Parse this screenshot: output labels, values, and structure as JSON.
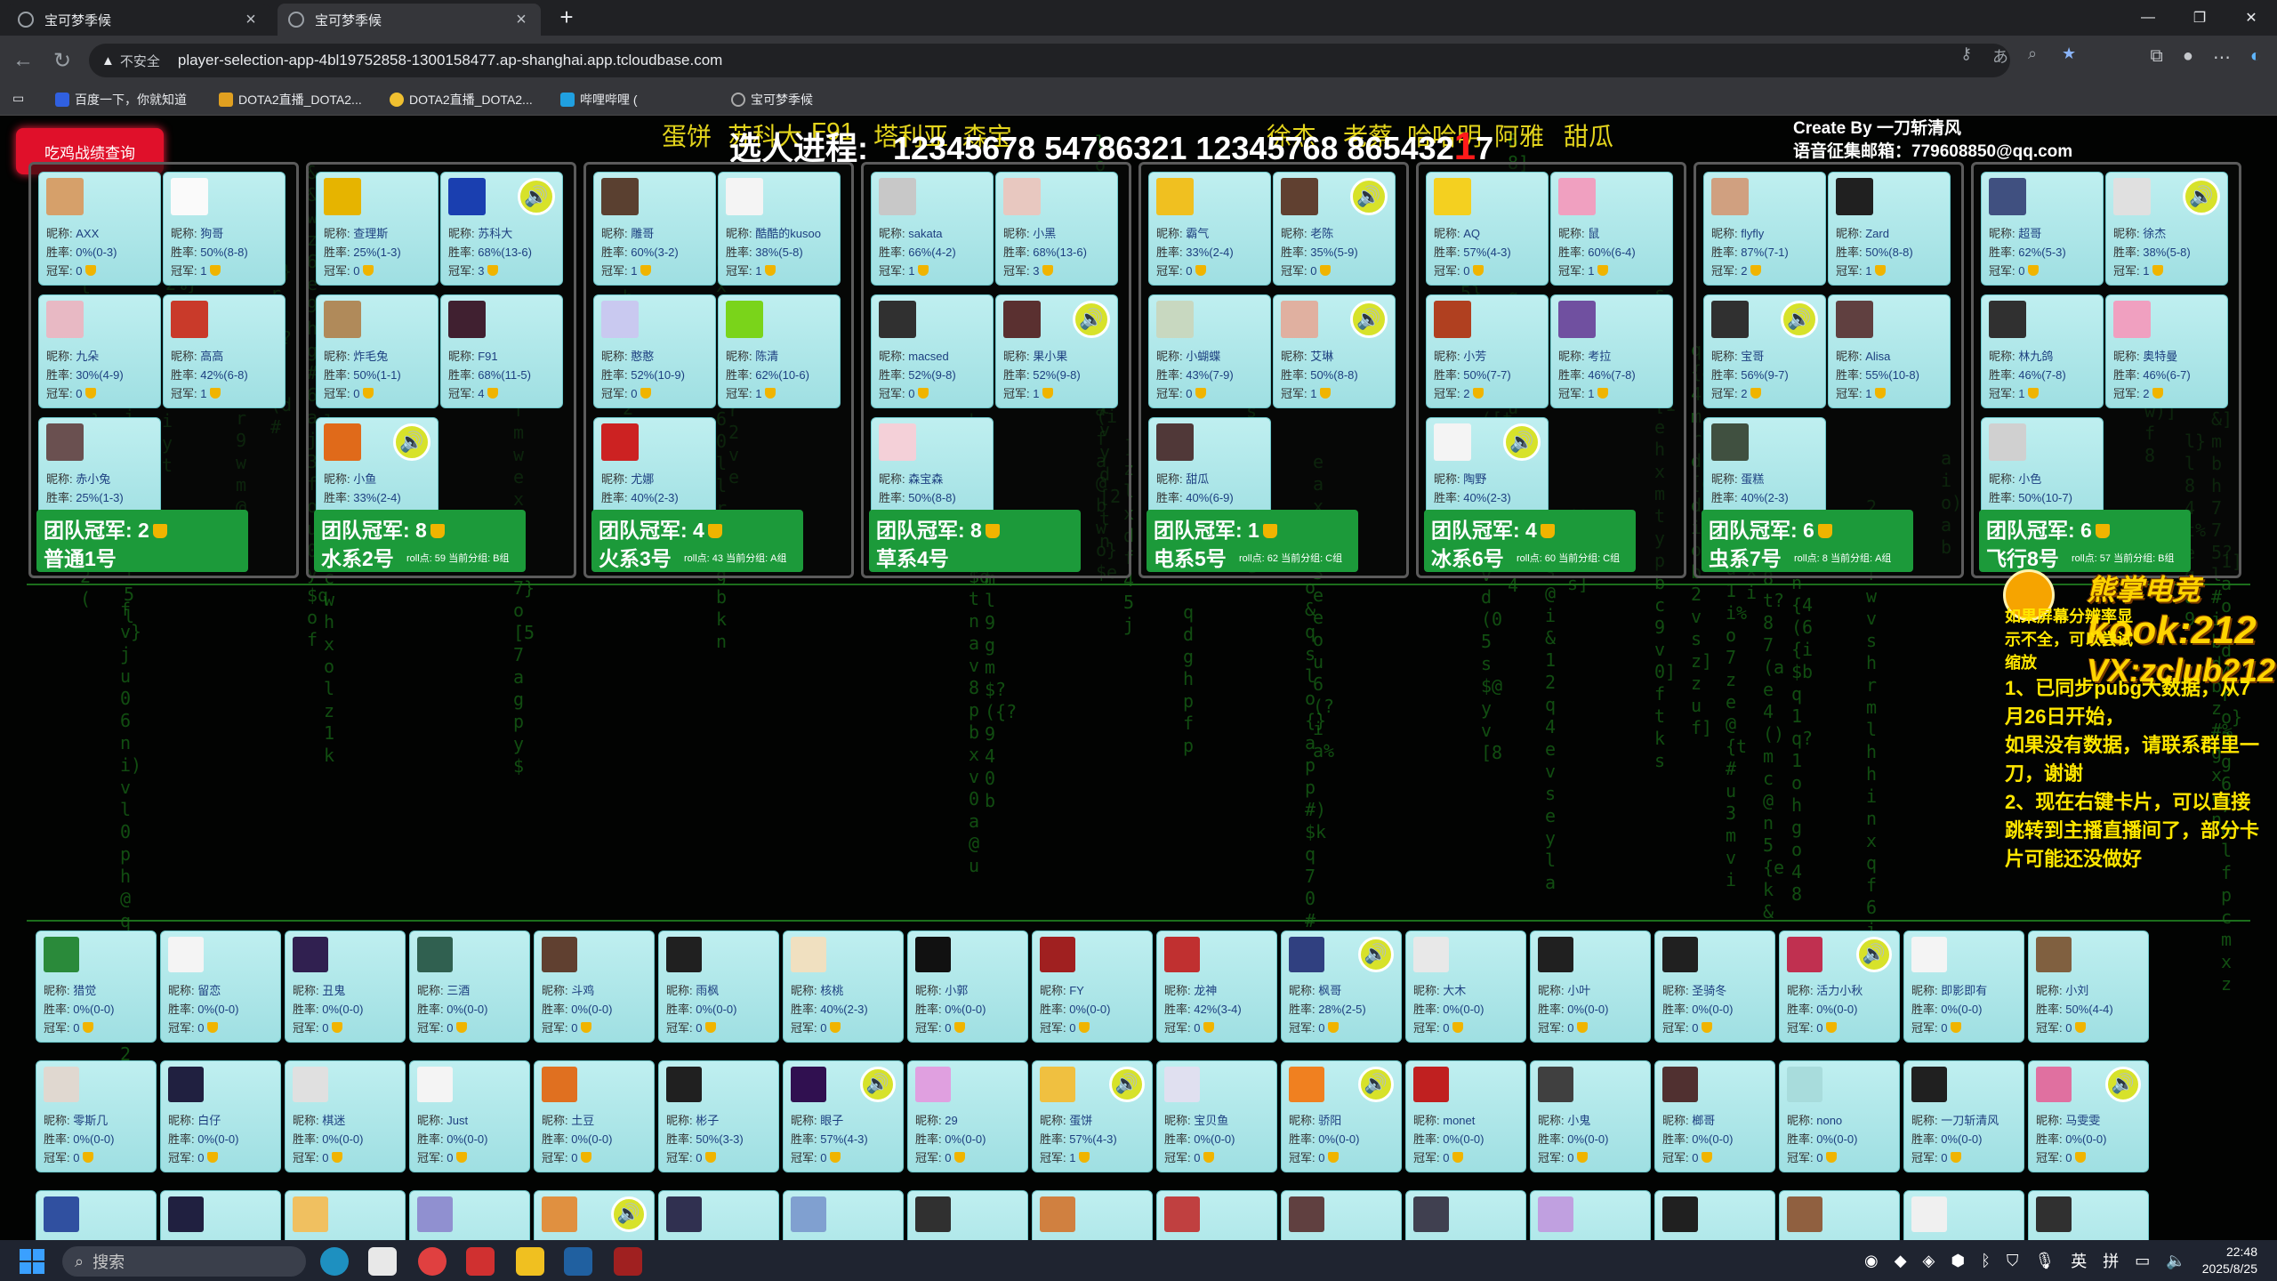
{
  "browser": {
    "tabs": [
      {
        "title": "宝可梦季候",
        "close": "×"
      },
      {
        "title": "宝可梦季候",
        "close": "×"
      }
    ],
    "new_tab": "+",
    "window_controls": {
      "minimize": "—",
      "restore": "❐",
      "close": "✕"
    },
    "address": {
      "security_label": "不安全",
      "url": "player-selection-app-4bl19752858-1300158477.ap-shanghai.app.tcloudbase.com"
    },
    "bookmarks": [
      "百度一下，你就知道",
      "DOTA2直播_DOTA2...",
      "DOTA2直播_DOTA2...",
      "哔哩哔哩 (",
      "宝可梦季候"
    ]
  },
  "page": {
    "marquee": [
      "蛋饼",
      "苏科大",
      "F91",
      "塔利亚",
      "森宝",
      "徐杰",
      "老蔡",
      "哈哈明",
      "阿雅",
      "甜瓜"
    ],
    "query_button": "吃鸡战绩查询",
    "progress_label": "选人进程:",
    "progress_value": "12345678 54786321 12345768 865432",
    "progress_red": "1",
    "progress_tail": "7",
    "creator_line1": "Create By 一刀斩清风",
    "creator_line2": "语音征集邮箱：779608850@qq.com",
    "notice_small": "如果屏幕分辨率显示不全，可以尝试缩放",
    "notice_lines": [
      "1、已同步pubg大数据，从7月26日开始，",
      "如果没有数据，请联系群里一刀，谢谢",
      "2、现在右键卡片，可以直接跳转到主播直播间了，部分卡片可能还没做好"
    ],
    "sponsor": {
      "brand": "熊掌电竞",
      "line1": "kook:212",
      "line2": "VX:zclub212"
    }
  },
  "labels": {
    "nick": "昵称: ",
    "win": "胜率: ",
    "champ": "冠军: ",
    "voice_icon": "🔊"
  },
  "colors": {
    "accent_green": "#1c9a3a",
    "card_bg": "#aee6e8",
    "query_red": "#e0102a",
    "marquee_yellow": "#e3d41c"
  },
  "teams": [
    {
      "champ": "团队冠军: 2",
      "name": "普通1号",
      "roll": "",
      "members": [
        {
          "nick": "AXX",
          "win": "0%(0-3)",
          "champ": "0",
          "avatar": "#d6a06a"
        },
        {
          "nick": "狗哥",
          "win": "50%(8-8)",
          "champ": "1",
          "avatar": "#fafafa",
          "voice": false
        },
        {
          "nick": "九朵",
          "win": "30%(4-9)",
          "champ": "0",
          "avatar": "#e8b9c4"
        },
        {
          "nick": "高高",
          "win": "42%(6-8)",
          "champ": "1",
          "avatar": "#c93a2a"
        },
        {
          "nick": "赤小兔",
          "win": "25%(1-3)",
          "champ": "0",
          "avatar": "#6a5050"
        }
      ]
    },
    {
      "champ": "团队冠军: 8",
      "name": "水系2号",
      "roll": "roll点: 59 当前分组: B组",
      "members": [
        {
          "nick": "查理斯",
          "win": "25%(1-3)",
          "champ": "0",
          "avatar": "#e6b400"
        },
        {
          "nick": "苏科大",
          "win": "68%(13-6)",
          "champ": "3",
          "avatar": "#1a3fb0",
          "voice": true
        },
        {
          "nick": "炸毛兔",
          "win": "50%(1-1)",
          "champ": "0",
          "avatar": "#b08a5a"
        },
        {
          "nick": "F91",
          "win": "68%(11-5)",
          "champ": "4",
          "avatar": "#402030"
        },
        {
          "nick": "小鱼",
          "win": "33%(2-4)",
          "champ": "1",
          "avatar": "#e06a1a",
          "voice": true
        }
      ]
    },
    {
      "champ": "团队冠军: 4",
      "name": "火系3号",
      "roll": "roll点: 43 当前分组: A组",
      "members": [
        {
          "nick": "雕哥",
          "win": "60%(3-2)",
          "champ": "1",
          "avatar": "#5a4030"
        },
        {
          "nick": "酷酷的kusoo",
          "win": "38%(5-8)",
          "champ": "1",
          "avatar": "#f4f4f4"
        },
        {
          "nick": "憨憨",
          "win": "52%(10-9)",
          "champ": "0",
          "avatar": "#c9c9f0"
        },
        {
          "nick": "陈清",
          "win": "62%(10-6)",
          "champ": "1",
          "avatar": "#7ad41a"
        },
        {
          "nick": "尤娜",
          "win": "40%(2-3)",
          "champ": "0",
          "avatar": "#cc2222"
        }
      ]
    },
    {
      "champ": "团队冠军: 8",
      "name": "草系4号",
      "roll": "",
      "members": [
        {
          "nick": "sakata",
          "win": "66%(4-2)",
          "champ": "1",
          "avatar": "#c8c8c8"
        },
        {
          "nick": "小黑",
          "win": "68%(13-6)",
          "champ": "3",
          "avatar": "#e8c8c0"
        },
        {
          "nick": "macsed",
          "win": "52%(9-8)",
          "champ": "0",
          "avatar": "#303030"
        },
        {
          "nick": "果小果",
          "win": "52%(9-8)",
          "champ": "1",
          "avatar": "#5a3030",
          "voice": true
        },
        {
          "nick": "森宝森",
          "win": "50%(8-8)",
          "champ": "0",
          "avatar": "#f4d0d8"
        }
      ]
    },
    {
      "champ": "团队冠军: 1",
      "name": "电系5号",
      "roll": "roll点: 62 当前分组: C组",
      "members": [
        {
          "nick": "霸气",
          "win": "33%(2-4)",
          "champ": "0",
          "avatar": "#f0c020"
        },
        {
          "nick": "老陈",
          "win": "35%(5-9)",
          "champ": "0",
          "avatar": "#604030",
          "voice": true
        },
        {
          "nick": "小蝴蝶",
          "win": "43%(7-9)",
          "champ": "0",
          "avatar": "#c8d8c0"
        },
        {
          "nick": "艾琳",
          "win": "50%(8-8)",
          "champ": "1",
          "avatar": "#e0b0a0",
          "voice": true
        },
        {
          "nick": "甜瓜",
          "win": "40%(6-9)",
          "champ": "0",
          "avatar": "#503838"
        }
      ]
    },
    {
      "champ": "团队冠军: 4",
      "name": "冰系6号",
      "roll": "roll点: 60 当前分组: C组",
      "members": [
        {
          "nick": "AQ",
          "win": "57%(4-3)",
          "champ": "0",
          "avatar": "#f4d020"
        },
        {
          "nick": "鼠",
          "win": "60%(6-4)",
          "champ": "1",
          "avatar": "#f0a0c0"
        },
        {
          "nick": "小芳",
          "win": "50%(7-7)",
          "champ": "2",
          "avatar": "#b04020"
        },
        {
          "nick": "考拉",
          "win": "46%(7-8)",
          "champ": "1",
          "avatar": "#7050a0"
        },
        {
          "nick": "陶野",
          "win": "40%(2-3)",
          "champ": "0",
          "avatar": "#f4f4f4",
          "voice": true
        }
      ]
    },
    {
      "champ": "团队冠军: 6",
      "name": "虫系7号",
      "roll": "roll点: 8 当前分组: A组",
      "members": [
        {
          "nick": "flyfly",
          "win": "87%(7-1)",
          "champ": "2",
          "avatar": "#d0a080"
        },
        {
          "nick": "Zard",
          "win": "50%(8-8)",
          "champ": "1",
          "avatar": "#202020"
        },
        {
          "nick": "宝哥",
          "win": "56%(9-7)",
          "champ": "2",
          "avatar": "#303030",
          "voice": true
        },
        {
          "nick": "Alisa",
          "win": "55%(10-8)",
          "champ": "1",
          "avatar": "#604040"
        },
        {
          "nick": "蛋糕",
          "win": "40%(2-3)",
          "champ": "0",
          "avatar": "#405040"
        }
      ]
    },
    {
      "champ": "团队冠军: 6",
      "name": "飞行8号",
      "roll": "roll点: 57 当前分组: B组",
      "members": [
        {
          "nick": "超哥",
          "win": "62%(5-3)",
          "champ": "0",
          "avatar": "#405080"
        },
        {
          "nick": "徐杰",
          "win": "38%(5-8)",
          "champ": "1",
          "avatar": "#e0e0e0",
          "voice": true
        },
        {
          "nick": "林九鸽",
          "win": "46%(7-8)",
          "champ": "1",
          "avatar": "#303030"
        },
        {
          "nick": "奥特曼",
          "win": "46%(6-7)",
          "champ": "2",
          "avatar": "#f0a0c0"
        },
        {
          "nick": "小色",
          "win": "50%(10-7)",
          "champ": "1",
          "avatar": "#d0d0d0"
        }
      ]
    }
  ],
  "pool": [
    [
      {
        "nick": "猎觉",
        "win": "0%(0-0)",
        "champ": "0",
        "avatar": "#2a8a3a"
      },
      {
        "nick": "留恋",
        "win": "0%(0-0)",
        "champ": "0",
        "avatar": "#f4f4f4"
      },
      {
        "nick": "丑鬼",
        "win": "0%(0-0)",
        "champ": "0",
        "avatar": "#302050"
      },
      {
        "nick": "三酒",
        "win": "0%(0-0)",
        "champ": "0",
        "avatar": "#306050"
      },
      {
        "nick": "斗鸡",
        "win": "0%(0-0)",
        "champ": "0",
        "avatar": "#604030"
      },
      {
        "nick": "雨枫",
        "win": "0%(0-0)",
        "champ": "0",
        "avatar": "#202020"
      },
      {
        "nick": "核桃",
        "win": "40%(2-3)",
        "champ": "0",
        "avatar": "#f0e0c0"
      },
      {
        "nick": "小郭",
        "win": "0%(0-0)",
        "champ": "0",
        "avatar": "#111111"
      },
      {
        "nick": "FY",
        "win": "0%(0-0)",
        "champ": "0",
        "avatar": "#a02020"
      },
      {
        "nick": "龙神",
        "win": "42%(3-4)",
        "champ": "0",
        "avatar": "#c03030"
      },
      {
        "nick": "枫哥",
        "win": "28%(2-5)",
        "champ": "0",
        "avatar": "#304080",
        "voice": true
      },
      {
        "nick": "大木",
        "win": "0%(0-0)",
        "champ": "0",
        "avatar": "#e8e8e8"
      },
      {
        "nick": "小叶",
        "win": "0%(0-0)",
        "champ": "0",
        "avatar": "#202020"
      },
      {
        "nick": "圣骑冬",
        "win": "0%(0-0)",
        "champ": "0",
        "avatar": "#202020"
      },
      {
        "nick": "活力小秋",
        "win": "0%(0-0)",
        "champ": "0",
        "avatar": "#c03050",
        "voice": true
      },
      {
        "nick": "即影即有",
        "win": "0%(0-0)",
        "champ": "0",
        "avatar": "#f4f4f4"
      },
      {
        "nick": "小刘",
        "win": "50%(4-4)",
        "champ": "0",
        "avatar": "#806040"
      }
    ],
    [
      {
        "nick": "零斯几",
        "win": "0%(0-0)",
        "champ": "0",
        "avatar": "#e0d8d0"
      },
      {
        "nick": "白仔",
        "win": "0%(0-0)",
        "champ": "0",
        "avatar": "#202040"
      },
      {
        "nick": "棋迷",
        "win": "0%(0-0)",
        "champ": "0",
        "avatar": "#e0e0e0"
      },
      {
        "nick": "Just",
        "win": "0%(0-0)",
        "champ": "0",
        "avatar": "#f4f4f4"
      },
      {
        "nick": "土豆",
        "win": "0%(0-0)",
        "champ": "0",
        "avatar": "#e07020"
      },
      {
        "nick": "彬子",
        "win": "50%(3-3)",
        "champ": "0",
        "avatar": "#202020"
      },
      {
        "nick": "眼子",
        "win": "57%(4-3)",
        "champ": "0",
        "avatar": "#301050",
        "voice": true
      },
      {
        "nick": "29",
        "win": "0%(0-0)",
        "champ": "0",
        "avatar": "#e0a0e0"
      },
      {
        "nick": "蛋饼",
        "win": "57%(4-3)",
        "champ": "1",
        "avatar": "#f0c040",
        "voice": true
      },
      {
        "nick": "宝贝鱼",
        "win": "0%(0-0)",
        "champ": "0",
        "avatar": "#e0e0f0"
      },
      {
        "nick": "骄阳",
        "win": "0%(0-0)",
        "champ": "0",
        "avatar": "#f08020",
        "voice": true
      },
      {
        "nick": "monet",
        "win": "0%(0-0)",
        "champ": "0",
        "avatar": "#c02020"
      },
      {
        "nick": "小鬼",
        "win": "0%(0-0)",
        "champ": "0",
        "avatar": "#404040"
      },
      {
        "nick": "榔哥",
        "win": "0%(0-0)",
        "champ": "0",
        "avatar": "#503030"
      },
      {
        "nick": "nono",
        "win": "0%(0-0)",
        "champ": "0",
        "avatar": "#a8dcdc"
      },
      {
        "nick": "一刀斩清风",
        "win": "0%(0-0)",
        "champ": "0",
        "avatar": "#202020"
      },
      {
        "nick": "马雯雯",
        "win": "0%(0-0)",
        "champ": "0",
        "avatar": "#e070a0",
        "voice": true
      }
    ],
    [
      {
        "avatar": "#3050a0"
      },
      {
        "avatar": "#202040"
      },
      {
        "avatar": "#f0c060"
      },
      {
        "avatar": "#9090d0"
      },
      {
        "avatar": "#e09040",
        "voice": true
      },
      {
        "avatar": "#303050"
      },
      {
        "avatar": "#80a0d0"
      },
      {
        "avatar": "#303030"
      },
      {
        "avatar": "#d08040"
      },
      {
        "avatar": "#c04040"
      },
      {
        "avatar": "#604040"
      },
      {
        "avatar": "#404050"
      },
      {
        "avatar": "#c0a0e0"
      },
      {
        "avatar": "#202020"
      },
      {
        "avatar": "#906040"
      },
      {
        "avatar": "#f0f0f0"
      },
      {
        "avatar": "#303030"
      }
    ]
  ],
  "taskbar": {
    "search": "搜索",
    "ime1": "英",
    "ime2": "拼",
    "time": "22:48",
    "date": "2025/8/25"
  }
}
